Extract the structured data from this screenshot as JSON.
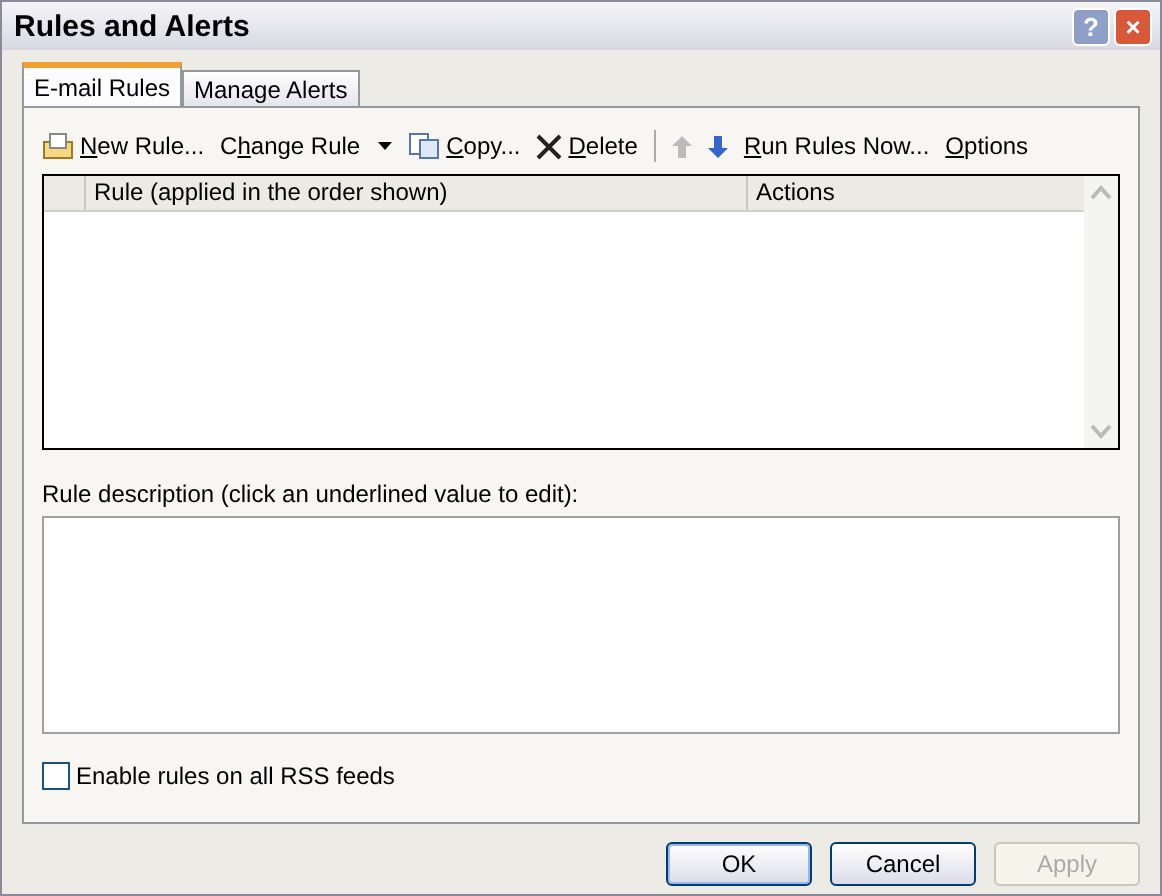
{
  "window": {
    "title": "Rules and Alerts",
    "title_buttons": [
      {
        "kind": "help",
        "label": "?"
      },
      {
        "kind": "close",
        "label": "×"
      }
    ]
  },
  "tabs": [
    {
      "label": "E-mail Rules",
      "selected": true
    },
    {
      "label": "Manage Alerts",
      "selected": false
    }
  ],
  "toolbar": [
    {
      "kind": "new",
      "access_key": "N",
      "label_rest": "ew Rule...",
      "disabled": false
    },
    {
      "kind": "menu",
      "label_start": "C",
      "access_key": "h",
      "label_rest": "ange Rule",
      "disabled": false
    },
    {
      "kind": "copy",
      "access_key": "C",
      "label_rest": "opy...",
      "disabled": false
    },
    {
      "kind": "delete",
      "access_key": "D",
      "label_rest": "elete",
      "disabled": false
    },
    {
      "kind": "separator"
    },
    {
      "kind": "up",
      "disabled": true
    },
    {
      "kind": "down",
      "disabled": false
    },
    {
      "kind": "text",
      "access_key": "R",
      "label_rest": "un Rules Now...",
      "disabled": false
    },
    {
      "kind": "text",
      "access_key": "O",
      "label_rest": "ptions",
      "disabled": false
    }
  ],
  "table": {
    "columns": [
      "Rule (applied in the order shown)",
      "Actions"
    ]
  },
  "description": {
    "label": "Rule description (click an underlined value to edit):"
  },
  "rss_checkbox": {
    "label": "Enable rules on all RSS feeds",
    "checked": false
  },
  "buttons": [
    {
      "label": "OK",
      "default": true,
      "disabled": false
    },
    {
      "label": "Cancel",
      "default": false,
      "disabled": false
    },
    {
      "label": "Apply",
      "default": false,
      "disabled": true
    }
  ]
}
